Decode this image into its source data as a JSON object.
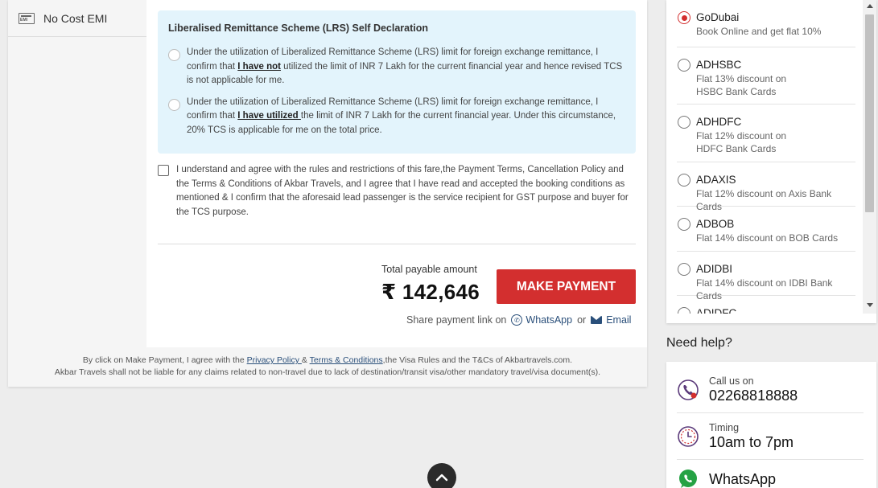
{
  "sidebar": {
    "emi": {
      "icon": "emi-card-icon",
      "icon_text": "EMI",
      "label": "No Cost EMI"
    }
  },
  "lrs": {
    "title": "Liberalised Remittance Scheme (LRS) Self Declaration",
    "option1": {
      "pre": "Under the utilization of Liberalized Remittance Scheme (LRS) limit for foreign exchange remittance, I confirm that ",
      "emph": "I have not",
      "post": " utilized the limit of INR 7 Lakh for the current financial year and hence revised TCS is not applicable for me."
    },
    "option2": {
      "pre": "Under the utilization of Liberalized Remittance Scheme (LRS) limit for foreign exchange remittance, I confirm that ",
      "emph": "I have utilized ",
      "post": "the limit of INR 7 Lakh for the current financial year. Under this circumstance, 20% TCS is applicable for me on the total price."
    }
  },
  "agreement": {
    "text": "I understand and agree with the rules and restrictions of this fare,the Payment Terms, Cancellation Policy and the Terms & Conditions of Akbar Travels, and I agree that I have read and accepted the booking conditions as mentioned & I confirm that the aforesaid lead passenger is the service recipient for GST purpose and buyer for the TCS purpose."
  },
  "payment": {
    "total_label": "Total payable amount",
    "total_amount": "₹ 142,646",
    "button_label": "MAKE PAYMENT",
    "share_label": "Share payment link on",
    "whatsapp": "WhatsApp",
    "or": "or",
    "email": "Email"
  },
  "footer": {
    "pre": "By click on Make Payment, I agree with the ",
    "privacy": "Privacy Policy ",
    "amp": "& ",
    "terms": "Terms & Conditions",
    "post": ",the Visa Rules and the T&Cs of Akbartravels.com.",
    "line2": "Akbar Travels shall not be liable for any claims related to non-travel due to lack of destination/transit visa/other mandatory travel/visa document(s)."
  },
  "coupons": [
    {
      "code": "GoDubai",
      "desc": "Book Online and get flat 10%",
      "selected": true
    },
    {
      "code": "ADHSBC",
      "desc1": "Flat 13% discount on",
      "desc2": "HSBC Bank Cards",
      "selected": false
    },
    {
      "code": "ADHDFC",
      "desc1": "Flat 12% discount on",
      "desc2": "HDFC Bank Cards",
      "selected": false
    },
    {
      "code": "ADAXIS",
      "desc": "Flat 12% discount on Axis Bank Cards",
      "selected": false
    },
    {
      "code": "ADBOB",
      "desc": "Flat 14% discount on BOB Cards",
      "selected": false
    },
    {
      "code": "ADIDBI",
      "desc": "Flat 14% discount on IDBI Bank Cards",
      "selected": false
    },
    {
      "code": "ADIDFC",
      "desc": "",
      "selected": false
    }
  ],
  "help": {
    "title": "Need help?",
    "call_label": "Call us on",
    "call_number": "02268818888",
    "timing_label": "Timing",
    "timing_value": "10am to 7pm",
    "whatsapp_label": "WhatsApp"
  },
  "colors": {
    "accent": "#d32f2f",
    "lrs_bg": "#e3f4fc",
    "link": "#2a4f7a",
    "whatsapp_green": "#25a244"
  },
  "icons": {
    "phone": "phone-icon",
    "clock": "clock-icon",
    "whatsapp": "whatsapp-icon",
    "scroll_top": "chevron-up-icon"
  }
}
